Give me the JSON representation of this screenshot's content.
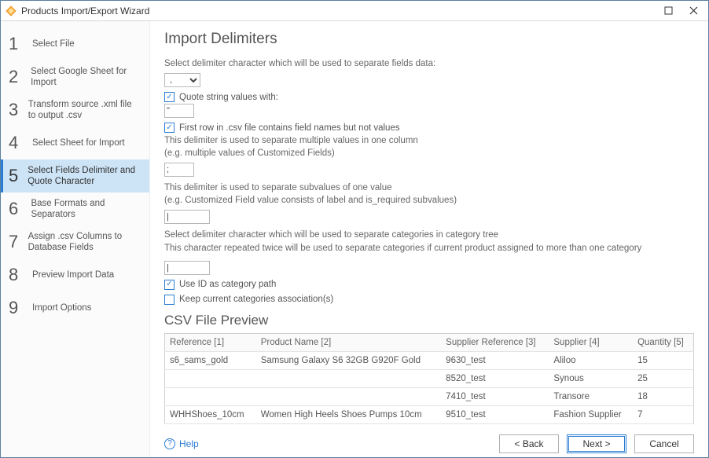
{
  "window": {
    "title": "Products Import/Export Wizard"
  },
  "sidebar": {
    "steps": [
      {
        "num": "1",
        "label": "Select File"
      },
      {
        "num": "2",
        "label": "Select Google Sheet for Import"
      },
      {
        "num": "3",
        "label": "Transform source .xml file to output .csv"
      },
      {
        "num": "4",
        "label": "Select Sheet for Import"
      },
      {
        "num": "5",
        "label": "Select Fields Delimiter and Quote Character"
      },
      {
        "num": "6",
        "label": "Base Formats and Separators"
      },
      {
        "num": "7",
        "label": "Assign .csv Columns to Database Fields"
      },
      {
        "num": "8",
        "label": "Preview Import Data"
      },
      {
        "num": "9",
        "label": "Import Options"
      }
    ],
    "active_index": 4
  },
  "main": {
    "heading": "Import Delimiters",
    "desc1": "Select delimiter character which will be used to separate fields data:",
    "delimiter_value": ",",
    "quote_checkbox_label": "Quote string values with:",
    "quote_value": "\"",
    "firstrow_checkbox_label": "First row in .csv file contains field names but not values",
    "multi_desc_line1": "This delimiter is used to separate multiple values in one column",
    "multi_desc_line2": "(e.g. multiple values of Customized Fields)",
    "multi_value": ";",
    "sub_desc_line1": "This delimiter is used to separate subvalues of one value",
    "sub_desc_line2": "(e.g. Customized Field value consists of label and is_required subvalues)",
    "sub_value": "|",
    "cat_desc_line1": "Select delimiter character which will be used to separate categories in category tree",
    "cat_desc_line2": "This character repeated twice will be used to separate categories if current product assigned to more than one category",
    "cat_value": "|",
    "useid_label": "Use ID as category path",
    "keepcat_label": "Keep current categories association(s)",
    "preview_heading": "CSV File Preview",
    "columns": {
      "c1": "Reference [1]",
      "c2": "Product Name [2]",
      "c3": "Supplier Reference [3]",
      "c4": "Supplier [4]",
      "c5": "Quantity [5]"
    },
    "rows": [
      {
        "c1": "s6_sams_gold",
        "c2": "Samsung Galaxy S6 32GB G920F Gold",
        "c3": "9630_test",
        "c4": "Aliloo",
        "c5": "15"
      },
      {
        "c1": "",
        "c2": "",
        "c3": "8520_test",
        "c4": "Synous",
        "c5": "25"
      },
      {
        "c1": "",
        "c2": "",
        "c3": "7410_test",
        "c4": "Transore",
        "c5": "18"
      },
      {
        "c1": "WHHShoes_10cm",
        "c2": "Women High Heels Shoes Pumps 10cm",
        "c3": "9510_test",
        "c4": "Fashion Supplier",
        "c5": "7"
      }
    ]
  },
  "footer": {
    "help": "Help",
    "back": "< Back",
    "next": "Next >",
    "cancel": "Cancel"
  }
}
